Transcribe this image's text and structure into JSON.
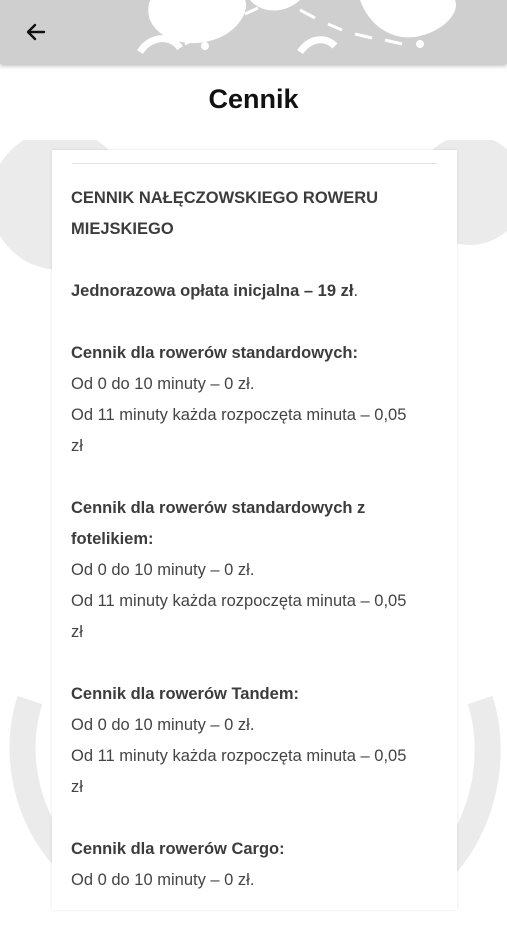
{
  "app_bar": {
    "back_icon": "arrow-left-icon",
    "background": "#cfcfcf"
  },
  "page": {
    "title": "Cennik"
  },
  "pricing": {
    "heading": "CENNIK NAŁĘCZOWSKIEGO ROWERU MIEJSKIEGO",
    "initial_fee_label": "Jednorazowa opłata inicjalna – 19 zł",
    "initial_fee_suffix": ".",
    "sections": [
      {
        "title": "Cennik dla rowerów standardowych:",
        "line1": "Od 0 do 10 minuty – 0 zł.",
        "line2": "Od 11 minuty każda rozpoczęta minuta – 0,05 zł"
      },
      {
        "title": "Cennik dla rowerów standardowych z fotelikiem:",
        "line1": "Od 0 do 10 minuty – 0 zł.",
        "line2": "Od 11 minuty każda rozpoczęta minuta – 0,05 zł"
      },
      {
        "title": "Cennik dla rowerów Tandem:",
        "line1": "Od 0 do 10 minuty – 0 zł.",
        "line2": "Od 11 minuty każda rozpoczęta minuta – 0,05 zł"
      },
      {
        "title": "Cennik dla rowerów Cargo:",
        "line1": "Od 0 do 10 minuty – 0 zł."
      }
    ]
  }
}
